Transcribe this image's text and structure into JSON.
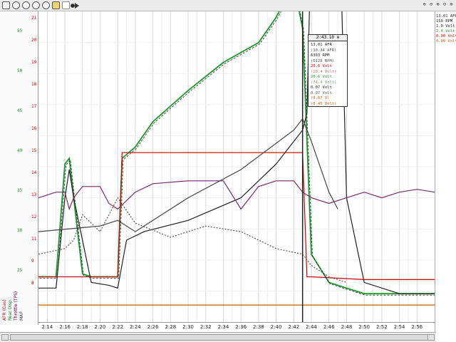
{
  "toolbar": {
    "buttons": [
      "print-icon",
      "zoom-in-icon",
      "zoom-out-icon",
      "zoom-fit-icon",
      "zoom-reset-icon",
      "notes-icon",
      "blank-page-icon",
      "record-icon",
      "play-icon"
    ],
    "right_caption": "⊕ ⊖ ⊗ ⊙ ⊚"
  },
  "left_axis": {
    "red_values": [
      "8",
      "9",
      "11",
      "12",
      "13",
      "14",
      "15",
      "16",
      "17",
      "18",
      "19",
      "20",
      "21"
    ],
    "green_values": [
      "25",
      "30",
      "35",
      "40",
      "45",
      "50",
      "55"
    ],
    "channel_labels": [
      {
        "text": "AFR (Gas)",
        "color": "#c00000"
      },
      {
        "text": "Rear Disp.",
        "color": "#208020"
      },
      {
        "text": "Throttle (TPS)",
        "color": "#800040"
      },
      {
        "text": "MAP",
        "color": "#404040"
      }
    ]
  },
  "chart_data": {
    "type": "line",
    "xlabel": "",
    "ylabel": "",
    "x_ticks": [
      "2:14",
      "2:16",
      "2:18",
      "2:20",
      "2:22",
      "2:24",
      "2:26",
      "2:28",
      "2:30",
      "2:32",
      "2:34",
      "2:36",
      "2:38",
      "2:40",
      "2:42",
      "2:44",
      "2:46",
      "2:48",
      "2:50",
      "2:52",
      "2:54",
      "2:56"
    ],
    "xlim": [
      2.13,
      2.58
    ],
    "ylim": [
      0,
      100
    ],
    "grid": true,
    "cursor_x": 2.43,
    "series": [
      {
        "color": "#1a9a2a",
        "x": [
          2.13,
          2.15,
          2.155,
          2.16,
          2.165,
          2.17,
          2.18,
          2.19,
          2.21,
          2.22,
          2.225,
          2.24,
          2.26,
          2.3,
          2.34,
          2.38,
          2.4,
          2.42,
          2.43,
          2.44,
          2.46,
          2.48,
          2.5,
          2.54,
          2.58
        ],
        "values": [
          12,
          12,
          32,
          52,
          54,
          40,
          13,
          12,
          12,
          12,
          54,
          58,
          67,
          78,
          88,
          95,
          104,
          116,
          100,
          20,
          10,
          8,
          6,
          6,
          6
        ]
      },
      {
        "color": "#202020",
        "x": [
          2.13,
          2.15,
          2.16,
          2.165,
          2.17,
          2.19,
          2.21,
          2.22,
          2.23,
          2.25,
          2.3,
          2.36,
          2.4,
          2.43,
          2.435,
          2.44,
          2.445,
          2.45,
          2.46,
          2.47,
          2.48,
          2.5,
          2.54,
          2.58
        ],
        "values": [
          8,
          8,
          40,
          50,
          40,
          10,
          9,
          8,
          25,
          28,
          32,
          40,
          52,
          64,
          70,
          135,
          150,
          190,
          200,
          165,
          40,
          10,
          6,
          6
        ]
      },
      {
        "color": "#cc0000",
        "x": [
          2.13,
          2.15,
          2.16,
          2.17,
          2.18,
          2.2,
          2.215,
          2.22,
          2.225,
          2.26,
          2.3,
          2.4,
          2.43,
          2.435,
          2.44,
          2.5,
          2.58
        ],
        "values": [
          12,
          12,
          12,
          12,
          12,
          12,
          12,
          12,
          56,
          56,
          56,
          56,
          56,
          12,
          12,
          11,
          11
        ]
      },
      {
        "color": "#7a2a6a",
        "x": [
          2.13,
          2.15,
          2.16,
          2.165,
          2.17,
          2.18,
          2.2,
          2.21,
          2.22,
          2.24,
          2.26,
          2.3,
          2.34,
          2.36,
          2.38,
          2.4,
          2.42,
          2.43,
          2.44,
          2.46,
          2.48,
          2.5,
          2.52,
          2.54,
          2.56,
          2.58
        ],
        "values": [
          40,
          42,
          42,
          36,
          40,
          44,
          44,
          38,
          36,
          42,
          45,
          46,
          46,
          36,
          44,
          46,
          46,
          42,
          40,
          38,
          40,
          42,
          40,
          42,
          43,
          42
        ]
      },
      {
        "color": "#555555",
        "dash": "2,2",
        "x": [
          2.13,
          2.16,
          2.17,
          2.18,
          2.2,
          2.22,
          2.24,
          2.28,
          2.32,
          2.36,
          2.4,
          2.43,
          2.44,
          2.46,
          2.48
        ],
        "values": [
          20,
          22,
          25,
          34,
          28,
          40,
          31,
          26,
          30,
          28,
          22,
          20,
          16,
          12,
          10
        ]
      },
      {
        "color": "#444444",
        "x": [
          2.13,
          2.2,
          2.22,
          2.24,
          2.3,
          2.36,
          2.42,
          2.43,
          2.44,
          2.46,
          2.47
        ],
        "values": [
          28,
          30,
          32,
          28,
          40,
          50,
          64,
          68,
          60,
          42,
          36
        ]
      },
      {
        "color": "#c06000",
        "x": [
          2.13,
          2.58
        ],
        "values": [
          2,
          2
        ]
      }
    ]
  },
  "cursor_box": {
    "header": "2:43.10 ⊕",
    "rows": [
      {
        "text": "13.01 AFR",
        "color": "#222222"
      },
      {
        "text": "(10.34 AFR)",
        "color": "#555555"
      },
      {
        "text": "6303 RPM",
        "color": "#222222"
      },
      {
        "text": "(6128 RPM)",
        "color": "#555555"
      },
      {
        "text": "20.6 Volt",
        "color": "#cc0000"
      },
      {
        "text": "(20.4 Volt)",
        "color": "#cc6666"
      },
      {
        "text": "20.6 Volt",
        "color": "#1a9a2a"
      },
      {
        "text": "(74.4 Volt)",
        "color": "#6aa06a"
      },
      {
        "text": "0.07 Volt",
        "color": "#222222"
      },
      {
        "text": "0.07 Volt",
        "color": "#555555"
      },
      {
        "text": "(0.07 V)",
        "color": "#c06000"
      },
      {
        "text": "(0.45 Volt)",
        "color": "#c06000"
      }
    ]
  },
  "legend": {
    "rows": [
      {
        "text": "13.01 AFR",
        "color": "#222222"
      },
      {
        "text": "150 RPM",
        "color": "#222222"
      },
      {
        "text": "1.0 Volt",
        "color": "#222222"
      },
      {
        "text": "2.4 Volt",
        "color": "#1a9a2a"
      },
      {
        "text": "0.00 Volt",
        "color": "#cc0000"
      },
      {
        "text": "0.00 Volt",
        "color": "#c06000"
      }
    ]
  }
}
